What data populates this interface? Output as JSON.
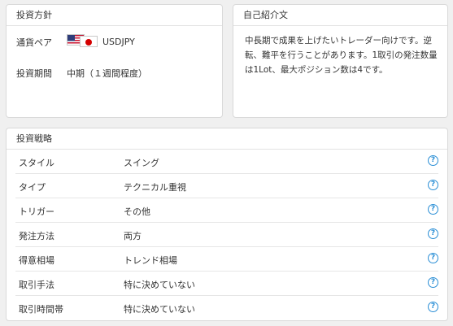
{
  "colors": {
    "help_icon": "#2b8fd6",
    "jp_sun": "#d40000",
    "us_red": "#c8102e",
    "us_blue": "#2f3d7a"
  },
  "policy": {
    "title": "投資方針",
    "currency_label": "通貨ペア",
    "currency_value": "USDJPY",
    "currency_icons": [
      "us-flag-icon",
      "jp-flag-icon"
    ],
    "period_label": "投資期間",
    "period_value": "中期（１週間程度）"
  },
  "intro": {
    "title": "自己紹介文",
    "text": "中長期で成果を上げたいトレーダー向けです。逆転、難平を行うことがあります。1取引の発注数量は1Lot、最大ポジション数は4です。"
  },
  "strategy": {
    "title": "投資戦略",
    "help_glyph": "?",
    "rows": [
      {
        "label": "スタイル",
        "value": "スイング"
      },
      {
        "label": "タイプ",
        "value": "テクニカル重視"
      },
      {
        "label": "トリガー",
        "value": "その他"
      },
      {
        "label": "発注方法",
        "value": "両方"
      },
      {
        "label": "得意相場",
        "value": "トレンド相場"
      },
      {
        "label": "取引手法",
        "value": "特に決めていない"
      },
      {
        "label": "取引時間帯",
        "value": "特に決めていない"
      }
    ]
  }
}
